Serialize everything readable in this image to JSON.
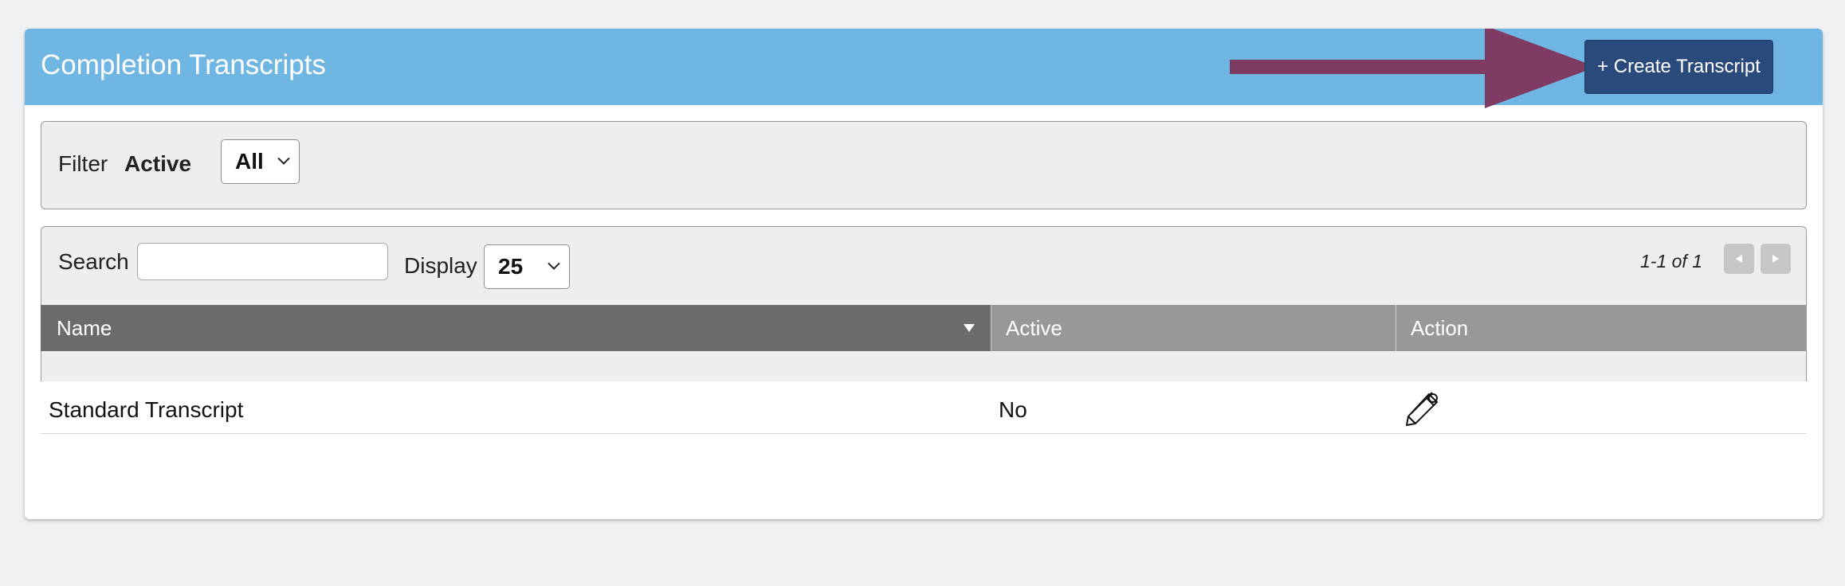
{
  "page": {
    "title": "Completion Transcripts",
    "create_button": "+ Create Transcript",
    "accent_color": "#6fb6e3",
    "button_color": "#2b4a7c",
    "arrow_color": "#803b62"
  },
  "filter": {
    "label": "Filter",
    "field_label": "Active",
    "selected": "All"
  },
  "table_controls": {
    "search_label": "Search",
    "search_value": "",
    "display_label": "Display",
    "display_selected": "25",
    "pager_text": "1-1 of 1"
  },
  "table": {
    "columns": [
      "Name",
      "Active",
      "Action"
    ],
    "sort_column": "Name",
    "rows": [
      {
        "name": "Standard Transcript",
        "active": "No",
        "action_icon": "pencil-icon"
      }
    ]
  },
  "icons": {
    "annotation": "arrow-right-icon",
    "select_chevron": "chevron-down-icon",
    "sort": "sort-down-icon",
    "pager_prev": "triangle-left-icon",
    "pager_next": "triangle-right-icon"
  }
}
